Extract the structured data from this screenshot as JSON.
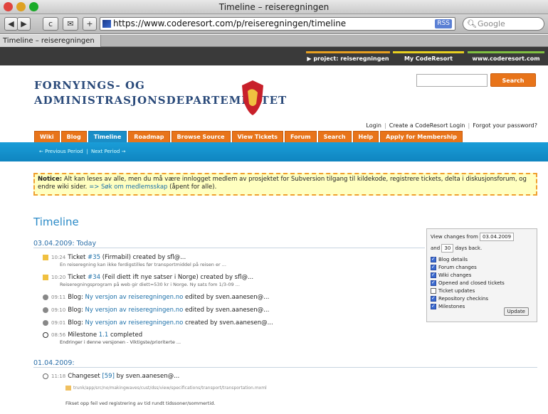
{
  "window": {
    "title": "Timeline – reiseregningen"
  },
  "toolbar": {
    "back": "◀",
    "forward": "▶",
    "reload": "c",
    "bookmark": "✉",
    "add": "+",
    "url": "https://www.coderesort.com/p/reiseregningen/timeline",
    "rss": "RSS",
    "search_placeholder": "Google"
  },
  "browser_tab": {
    "label": "Timeline – reiseregningen"
  },
  "topnav": {
    "project": "project: reiseregningen",
    "mycr": "My CodeResort (login)",
    "site": "www.coderesort.com"
  },
  "logo": {
    "line1": "FORNYINGS- OG",
    "line2": "ADMINISTRASJONSDEPARTEMENTET"
  },
  "search": {
    "button": "Search project"
  },
  "login": {
    "login": "Login",
    "create": "Create a CodeResort Login",
    "forgot": "Forgot your password?"
  },
  "nav": [
    "Wiki",
    "Blog",
    "Timeline",
    "Roadmap",
    "Browse Source",
    "View Tickets",
    "Forum",
    "Search",
    "Help",
    "Apply for Membership"
  ],
  "subnav": {
    "prev": "← Previous Period",
    "next": "Next Period →"
  },
  "notice": {
    "label": "Notice:",
    "text": "Alt kan leses av alle, men du må være innlogget medlem av prosjektet for Subversion tilgang til kildekode, registrere tickets, delta i diskusjonsforum, og endre wiki sider.",
    "link": "=> Søk om medlemsskap",
    "suffix": "(åpent for alle)."
  },
  "page": {
    "heading": "Timeline"
  },
  "day1": {
    "label": "03.04.2009: Today"
  },
  "day2": {
    "label": "01.04.2009:"
  },
  "entries": [
    {
      "time": "10:24",
      "pre": "Ticket ",
      "link": "#35",
      "post": " (Firmabil) created by sfl@...",
      "sub": "En reiseregning kan ikke ferdigstilles før transportmiddel på reisen er ..."
    },
    {
      "time": "10:20",
      "pre": "Ticket ",
      "link": "#34",
      "post": " (Feil diett ift nye satser i Norge) created by sfl@...",
      "sub": "Reiseregningsprogram på web gir diett=530 kr i Norge. Ny sats fom 1/3-09 ..."
    },
    {
      "time": "09:11",
      "pre": "Blog: ",
      "link": "Ny versjon av reiseregningen.no",
      "post": " edited by sven.aanesen@..."
    },
    {
      "time": "09:10",
      "pre": "Blog: ",
      "link": "Ny versjon av reiseregningen.no",
      "post": " edited by sven.aanesen@..."
    },
    {
      "time": "09:01",
      "pre": "Blog: ",
      "link": "Ny versjon av reiseregningen.no",
      "post": " created by sven.aanesen@..."
    },
    {
      "time": "08:56",
      "pre": "Milestone ",
      "link": "1.1",
      "post": " completed",
      "sub": "Endringer i denne versjonen - Viktigste/prioriterte ..."
    },
    {
      "time": "11:18",
      "pre": "Changeset ",
      "link": "[59]",
      "post": " by sven.aanesen@..."
    }
  ],
  "changeset": {
    "path": "trunk/app/src/no/makingwaves/cust/dss/view/specifications/transport/transportation.mxml",
    "msg": "Fikset opp feil ved registrering av tid rundt tidssoner/sommertid."
  },
  "filter": {
    "label_from": "View changes from",
    "date": "03.04.2009",
    "label_and": "and",
    "days": "30",
    "label_days": "days back.",
    "options": [
      {
        "label": "Blog details",
        "on": true
      },
      {
        "label": "Forum changes",
        "on": true
      },
      {
        "label": "Wiki changes",
        "on": true
      },
      {
        "label": "Opened and closed tickets",
        "on": true
      },
      {
        "label": "Ticket updates",
        "on": false
      },
      {
        "label": "Repository checkins",
        "on": true
      },
      {
        "label": "Milestones",
        "on": true
      }
    ],
    "update": "Update"
  }
}
